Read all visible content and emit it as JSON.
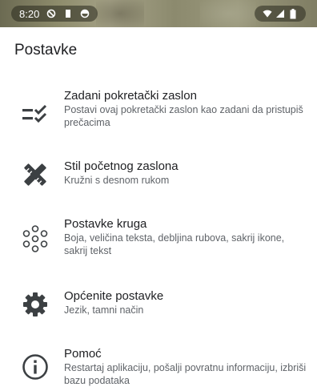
{
  "status_bar": {
    "time": "8:20",
    "left_icons": [
      "dnd-icon",
      "sd-card-icon",
      "circle-icon"
    ],
    "right_icons": [
      "wifi-icon",
      "signal-icon",
      "battery-icon"
    ]
  },
  "page": {
    "title": "Postavke"
  },
  "items": [
    {
      "title": "Zadani pokretački zaslon",
      "subtitle": "Postavi ovaj pokretački zaslon kao zadani da pristupiš prečacima",
      "icon": "checklist-icon"
    },
    {
      "title": "Stil početnog zaslona",
      "subtitle": "Kružni s desnom rukom",
      "icon": "design-tools-icon"
    },
    {
      "title": "Postavke kruga",
      "subtitle": "Boja, veličina teksta, debljina rubova, sakrij ikone, sakrij tekst",
      "icon": "circle-dots-icon"
    },
    {
      "title": "Općenite postavke",
      "subtitle": "Jezik, tamni način",
      "icon": "gear-icon"
    },
    {
      "title": "Pomoć",
      "subtitle": "Restartaj aplikaciju, pošalji povratnu informaciju, izbriši bazu podataka",
      "icon": "info-icon"
    }
  ]
}
